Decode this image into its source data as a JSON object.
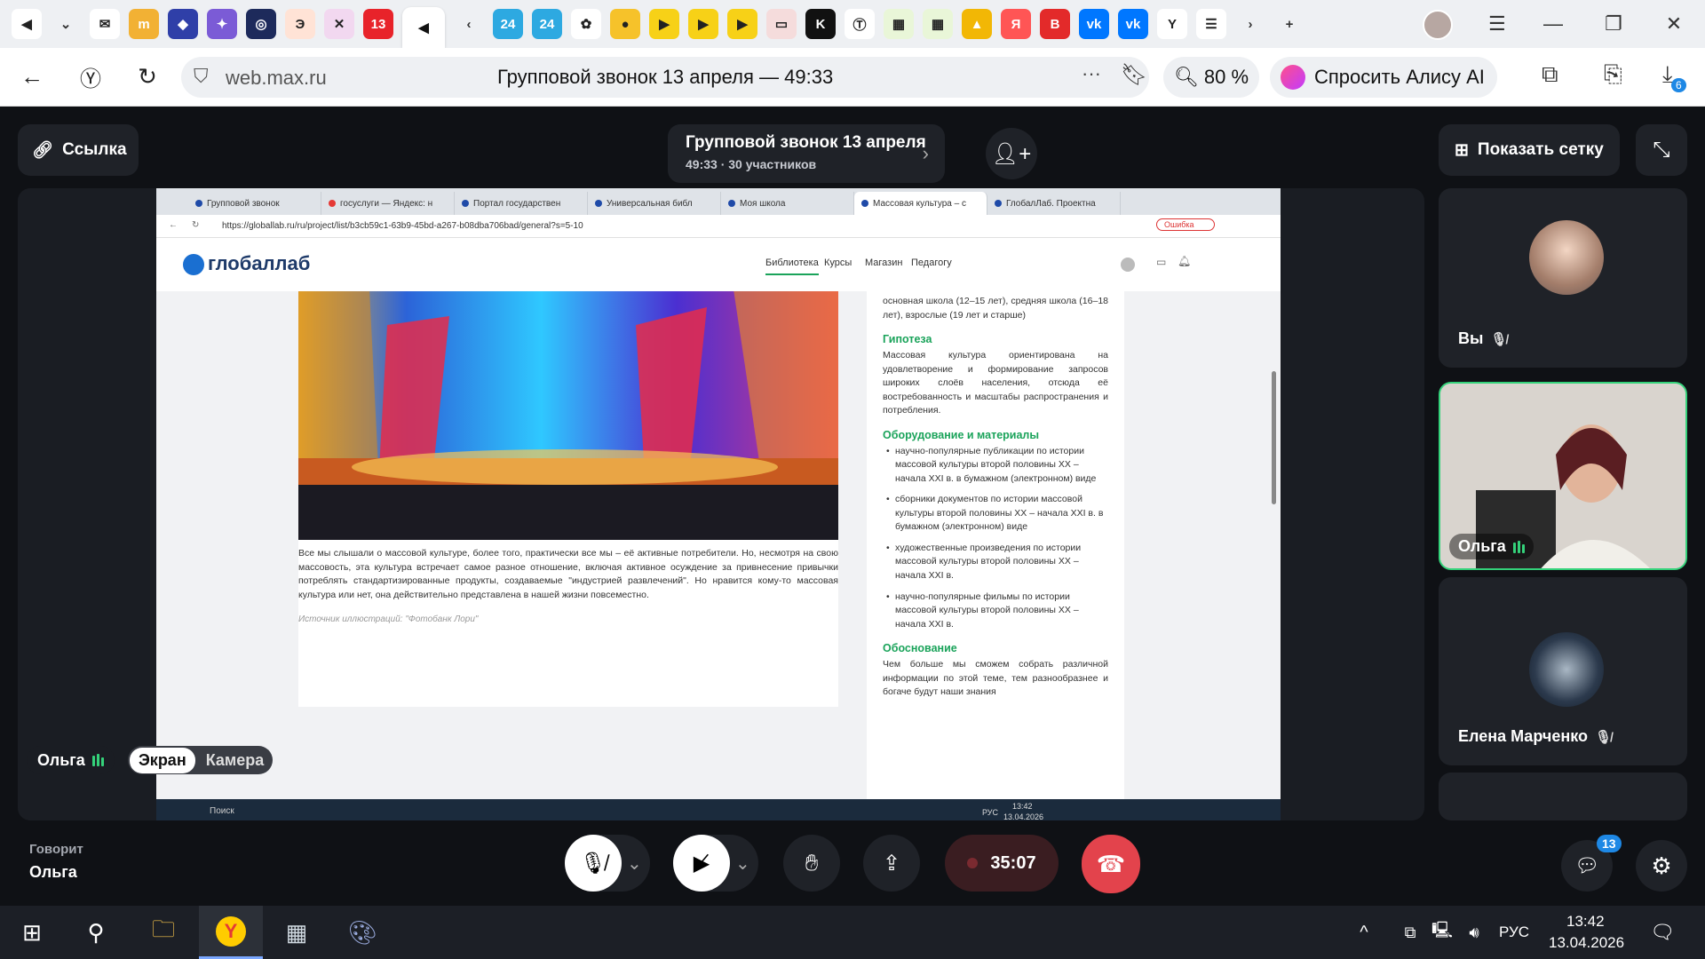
{
  "browser": {
    "tab_icons": [
      {
        "name": "speaker-tab",
        "glyph": "◀",
        "color": "#ffffff"
      },
      {
        "name": "chevron-down",
        "glyph": "⌄",
        "color": "transparent"
      },
      {
        "name": "mail-tab",
        "glyph": "✉",
        "color": "#ffffff"
      },
      {
        "name": "tab-2",
        "glyph": "m",
        "color": "#f2b134"
      },
      {
        "name": "tab-3",
        "glyph": "◆",
        "color": "#2f3fa8"
      },
      {
        "name": "tab-4",
        "glyph": "✦",
        "color": "#7b5bd6"
      },
      {
        "name": "tab-5",
        "glyph": "◎",
        "color": "#1d2a5b"
      },
      {
        "name": "tab-6",
        "glyph": "Э",
        "color": "#ffe3d6"
      },
      {
        "name": "tab-7",
        "glyph": "✕",
        "color": "#f2d8f0"
      },
      {
        "name": "tab-13",
        "glyph": "13",
        "color": "#e8232a"
      },
      {
        "name": "active-speaker-tab",
        "glyph": "◀",
        "color": "#ffffff"
      },
      {
        "name": "tabs-left",
        "glyph": "‹",
        "color": "transparent"
      },
      {
        "name": "tab-24a",
        "glyph": "24",
        "color": "#2da9e1"
      },
      {
        "name": "tab-24b",
        "glyph": "24",
        "color": "#2da9e1"
      },
      {
        "name": "tab-photos",
        "glyph": "✿",
        "color": "#ffffff"
      },
      {
        "name": "tab-notes",
        "glyph": "●",
        "color": "#f6c22a"
      },
      {
        "name": "tab-yt1",
        "glyph": "▶",
        "color": "#f7d117"
      },
      {
        "name": "tab-yt2",
        "glyph": "▶",
        "color": "#f7d117"
      },
      {
        "name": "tab-yt3",
        "glyph": "▶",
        "color": "#f7d117"
      },
      {
        "name": "tab-doc",
        "glyph": "▭",
        "color": "#f5dcdc"
      },
      {
        "name": "tab-k",
        "glyph": "K",
        "color": "#111111"
      },
      {
        "name": "tab-t",
        "glyph": "Ⓣ",
        "color": "#ffffff"
      },
      {
        "name": "tab-g1",
        "glyph": "▦",
        "color": "#e9f6d8"
      },
      {
        "name": "tab-g2",
        "glyph": "▦",
        "color": "#e9f6d8"
      },
      {
        "name": "tab-pic",
        "glyph": "▲",
        "color": "#f2b705"
      },
      {
        "name": "tab-ya",
        "glyph": "Я",
        "color": "#f55"
      },
      {
        "name": "tab-red",
        "glyph": "В",
        "color": "#e32a2a"
      },
      {
        "name": "tab-vk1",
        "glyph": "vk",
        "color": "#0077ff"
      },
      {
        "name": "tab-vk2",
        "glyph": "vk",
        "color": "#0077ff"
      },
      {
        "name": "tab-y",
        "glyph": "Y",
        "color": "#ffffff"
      },
      {
        "name": "tab-list",
        "glyph": "☰",
        "color": "#ffffff"
      },
      {
        "name": "tabs-right",
        "glyph": "›",
        "color": "transparent"
      },
      {
        "name": "new-tab",
        "glyph": "+",
        "color": "transparent"
      }
    ],
    "url": "web.max.ru",
    "page_title": "Групповой звонок 13 апреля — 49:33",
    "zoom": "80 %",
    "alice_label": "Спросить Алису AI",
    "downloads_badge": "6"
  },
  "call": {
    "link_label": "Ссылка",
    "title": "Групповой звонок 13 апреля",
    "subtitle": "49:33 · 30 участников",
    "grid_label": "Показать сетку",
    "presenter_name": "Ольга",
    "screen_tab": "Экран",
    "camera_tab": "Камера",
    "speaking_label": "Говорит",
    "speaking_name": "Ольга",
    "timer": "35:07",
    "chat_badge": "13",
    "participants": [
      {
        "name": "Вы",
        "muted": true
      },
      {
        "name": "Ольга",
        "muted": false
      },
      {
        "name": "Елена Марченко",
        "muted": true
      }
    ]
  },
  "shared_screen": {
    "tabs": [
      "Групповой звонок",
      "госуслуги — Яндекс: н",
      "Портал государствен",
      "Универсальная библ",
      "Моя школа",
      "Массовая культура – с",
      "ГлобалЛаб. Проектна"
    ],
    "url": "https://globallab.ru/ru/project/list/b3cb59c1-63b9-45bd-a267-b08dba706bad/general?s=5-10",
    "error_label": "Ошибка",
    "logo": "глобаллаб",
    "nav": [
      "Библиотека",
      "Курсы",
      "Магазин",
      "Педагогу"
    ],
    "age_text": "основная школа (12–15 лет), средняя школа (16–18 лет), взрослые (19 лет и старше)",
    "hypothesis_title": "Гипотеза",
    "hypothesis_text": "Массовая культура ориентирована на удовлетворение и формирование запросов широких слоёв населения, отсюда её востребованность и масштабы распространения и потребления.",
    "equipment_title": "Оборудование и материалы",
    "equipment": [
      "научно-популярные публикации по истории массовой культуры второй половины XX – начала XXI в. в бумажном (электронном) виде",
      "сборники документов по истории массовой культуры второй половины XX – начала XXI в. в бумажном (электронном) виде",
      "художественные произведения по истории массовой культуры второй половины XX – начала XXI в.",
      "научно-популярные фильмы по истории массовой культуры второй половины XX – начала XXI в."
    ],
    "reason_title": "Обоснование",
    "reason_text": "Чем больше мы сможем собрать различной информации по этой теме, тем разнообразнее и богаче будут наши знания",
    "article_text": "Все мы слышали о массовой культуре, более того, практически все мы – её активные потребители. Но, несмотря на свою массовость, эта культура встречает самое разное отношение, включая активное осуждение за привнесение привычки потреблять стандартизированные продукты, создаваемые \"индустрией развлечений\". Но нравится кому-то массовая культура или нет, она действительно представлена в нашей жизни повсеместно.",
    "source_text": "Источник иллюстраций: \"Фотобанк Лори\"",
    "taskbar_search": "Поиск",
    "taskbar_lang": "РУС",
    "taskbar_time": "13:42",
    "taskbar_date": "13.04.2026"
  },
  "taskbar": {
    "lang": "РУС",
    "time": "13:42",
    "date": "13.04.2026"
  }
}
